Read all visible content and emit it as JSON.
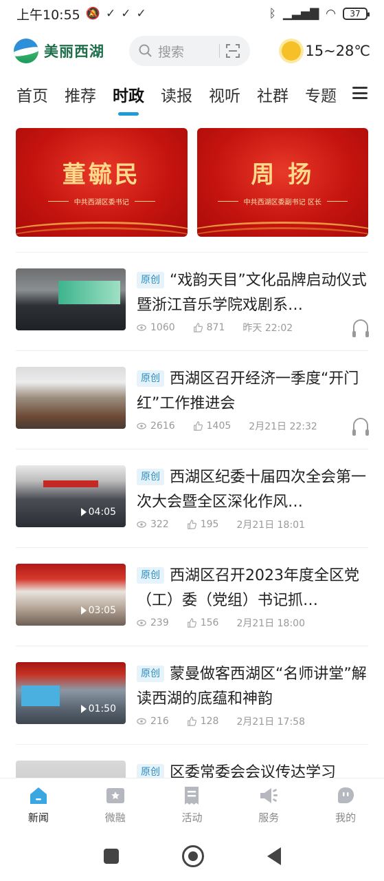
{
  "status_bar": {
    "time": "上午10:55",
    "battery": "37"
  },
  "header": {
    "app_name": "美丽西湖",
    "search_placeholder": "搜索",
    "weather": "15~28℃"
  },
  "tabs": [
    {
      "label": "首页"
    },
    {
      "label": "推荐"
    },
    {
      "label": "时政",
      "active": true
    },
    {
      "label": "读报"
    },
    {
      "label": "视听"
    },
    {
      "label": "社群"
    },
    {
      "label": "专题"
    }
  ],
  "banners": [
    {
      "name": "董毓民",
      "subtitle": "中共西湖区委书记"
    },
    {
      "name": "周 扬",
      "subtitle": "中共西湖区委副书记  区长"
    }
  ],
  "news": [
    {
      "tag": "原创",
      "title": "“戏韵天目”文化品牌启动仪式暨浙江音乐学院戏剧系…",
      "views": "1060",
      "likes": "871",
      "time": "昨天 22:02",
      "duration": "",
      "listen": true
    },
    {
      "tag": "原创",
      "title": "西湖区召开经济一季度“开门红”工作推进会",
      "views": "2616",
      "likes": "1405",
      "time": "2月21日 22:32",
      "duration": "",
      "listen": true
    },
    {
      "tag": "原创",
      "title": "西湖区纪委十届四次全会第一次大会暨全区深化作风…",
      "views": "322",
      "likes": "195",
      "time": "2月21日 18:01",
      "duration": "04:05",
      "listen": false
    },
    {
      "tag": "原创",
      "title": "西湖区召开2023年度全区党（工）委（党组）书记抓…",
      "views": "239",
      "likes": "156",
      "time": "2月21日 18:00",
      "duration": "03:05",
      "listen": false
    },
    {
      "tag": "原创",
      "title": "蒙曼做客西湖区“名师讲堂”解读西湖的底蕴和神韵",
      "views": "216",
      "likes": "128",
      "time": "2月21日 17:58",
      "duration": "01:50",
      "listen": false
    },
    {
      "tag": "原创",
      "title": "区委常委会会议传达学习",
      "views": "",
      "likes": "",
      "time": "",
      "duration": "",
      "listen": false
    }
  ],
  "bottom_nav": [
    {
      "label": "新闻",
      "icon": "home-icon",
      "active": true
    },
    {
      "label": "微融",
      "icon": "star-card-icon"
    },
    {
      "label": "活动",
      "icon": "receipt-icon"
    },
    {
      "label": "服务",
      "icon": "megaphone-icon"
    },
    {
      "label": "我的",
      "icon": "profile-icon"
    }
  ],
  "colors": {
    "accent": "#1e9bd8",
    "tag_text": "#2a8cc4",
    "tag_bg": "#e6f3fb",
    "banner_red": "#c6140f"
  }
}
